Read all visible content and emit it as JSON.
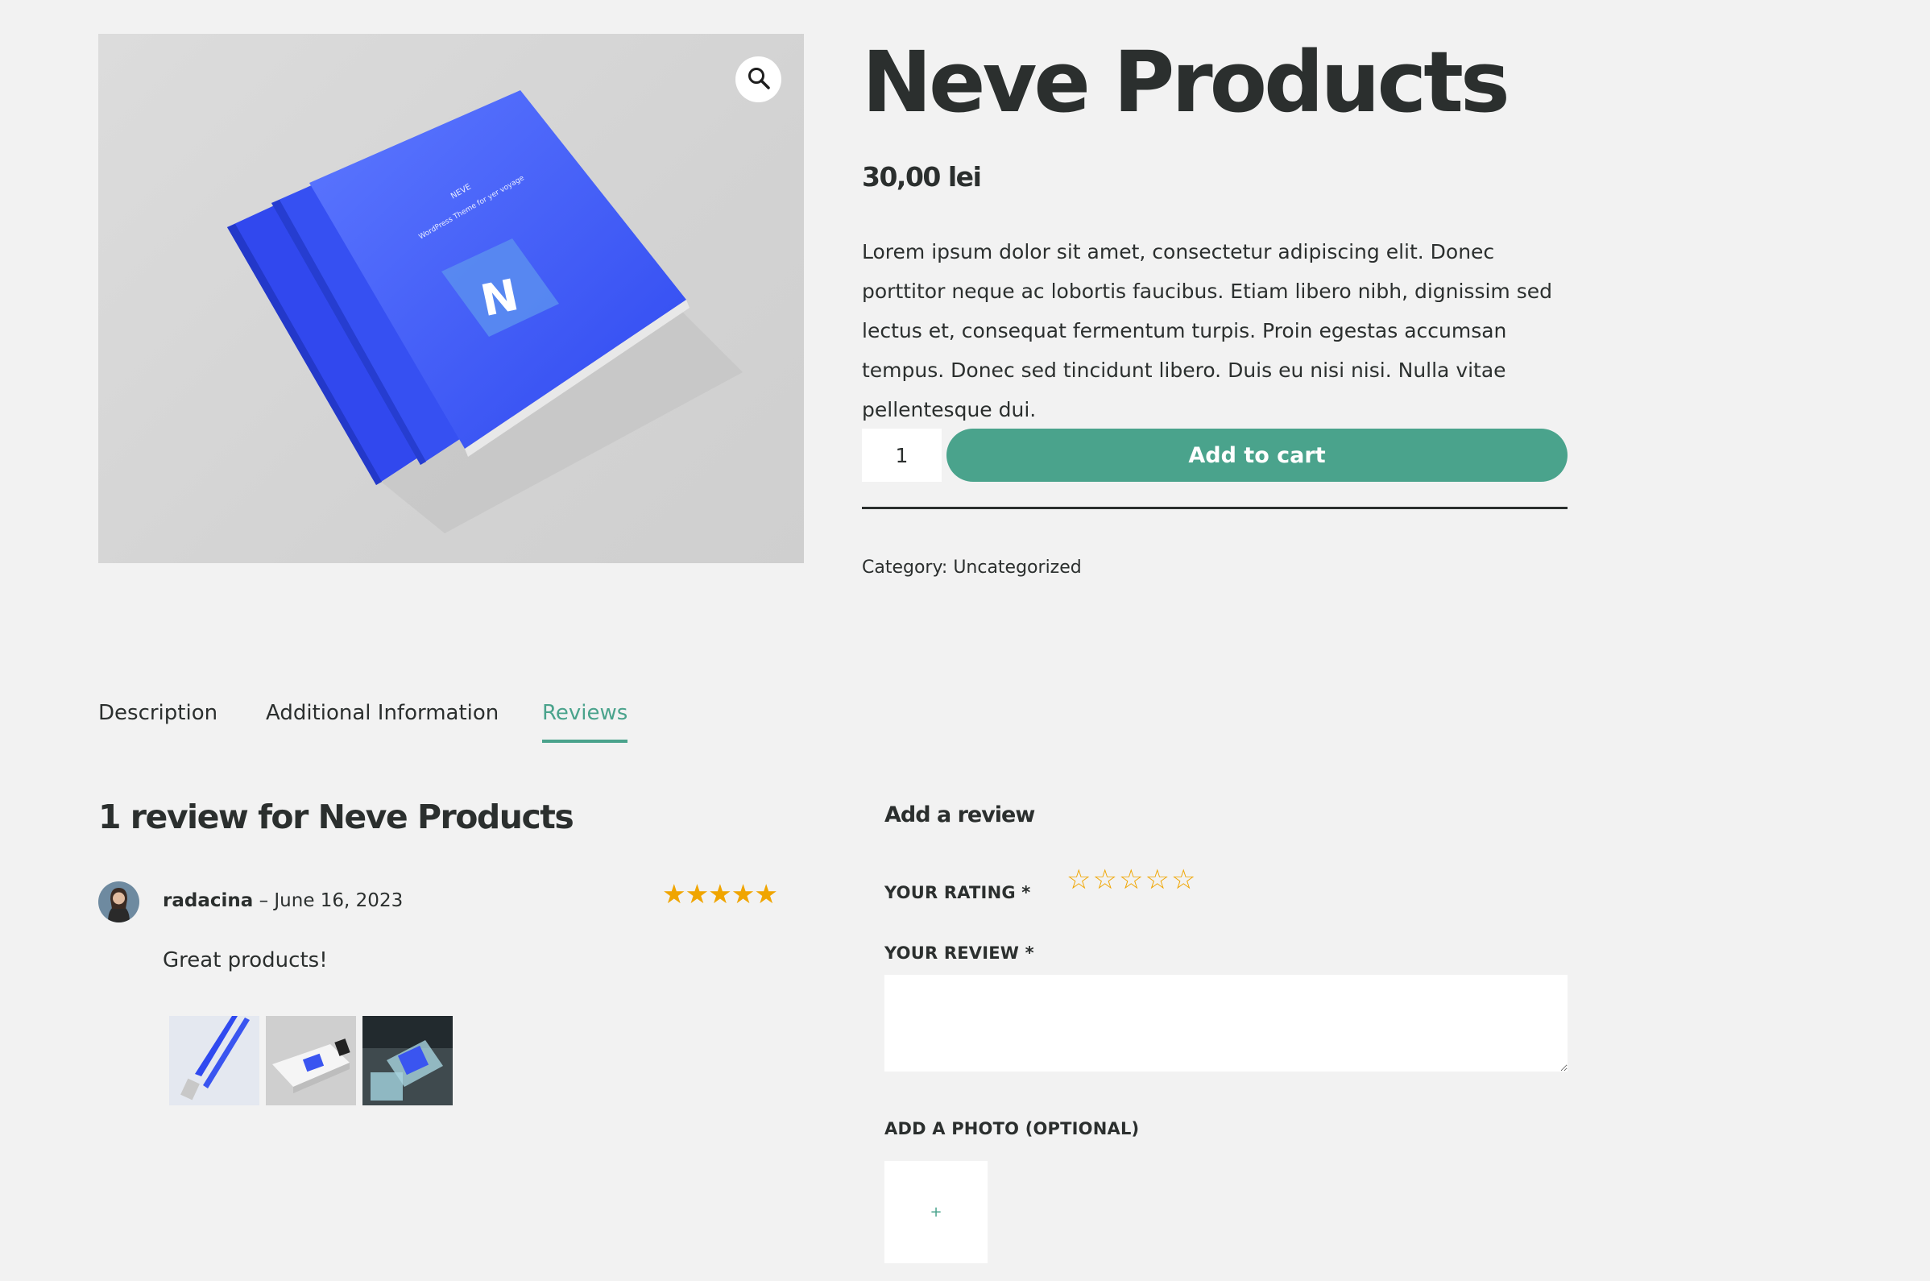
{
  "product": {
    "title": "Neve Products",
    "price": "30,00 lei",
    "description": "Lorem ipsum dolor sit amet, consectetur adipiscing elit. Donec porttitor neque ac lobortis faucibus. Etiam libero nibh, dignissim sed lectus et, consequat fermentum turpis. Proin egestas accumsan tempus. Donec sed tincidunt libero. Duis eu nisi nisi. Nulla vitae pellentesque dui.",
    "quantity": "1",
    "add_to_cart_label": "Add to cart",
    "category_label": "Category:",
    "category_value": "Uncategorized",
    "image": {
      "brand_line1": "NEVE",
      "brand_line2": "WordPress Theme for yer voyage",
      "logo_letter": "N"
    }
  },
  "tabs": [
    {
      "label": "Description",
      "active": false
    },
    {
      "label": "Additional Information",
      "active": false
    },
    {
      "label": "Reviews",
      "active": true
    }
  ],
  "reviews": {
    "heading": "1 review for Neve Products",
    "items": [
      {
        "author": "radacina",
        "separator": " – ",
        "date": "June 16, 2023",
        "rating": 5,
        "stars": "★★★★★",
        "text": "Great products!"
      }
    ]
  },
  "add_review": {
    "heading": "Add a review",
    "rating_label": "YOUR RATING *",
    "rating_stars": [
      "☆",
      "☆",
      "☆",
      "☆",
      "☆"
    ],
    "review_label": "YOUR REVIEW *",
    "photo_label": "ADD A PHOTO (OPTIONAL)",
    "photo_button": "+"
  },
  "colors": {
    "accent": "#4aa38c",
    "star": "#f0a500",
    "text": "#2b2f2e",
    "background": "#f2f2f2",
    "product_blue": "#3a55f0"
  }
}
